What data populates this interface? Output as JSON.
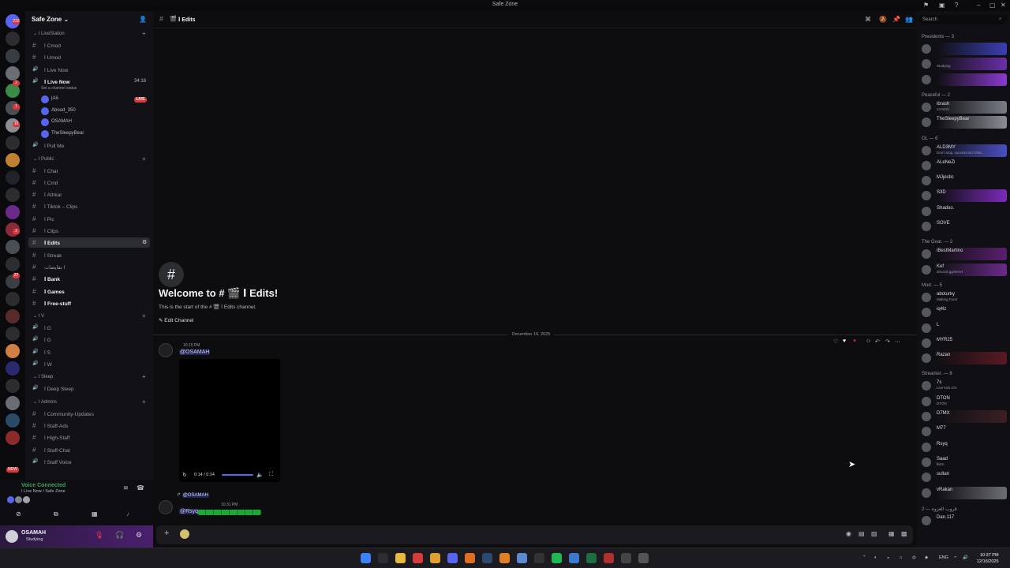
{
  "window": {
    "title": "Safe Zone"
  },
  "rail": {
    "top_badge": "232",
    "badges": [
      "2",
      "1",
      "10",
      "2",
      "27"
    ],
    "new_badge": "NEW"
  },
  "sidebar": {
    "server_name": "Safe Zone",
    "items": [
      {
        "type": "cat",
        "label": "ا LiveStation",
        "y": 25
      },
      {
        "type": "ch",
        "icon": "#",
        "label": "ا Cmod"
      },
      {
        "type": "ch",
        "icon": "#",
        "label": "ا Umod"
      },
      {
        "type": "vc",
        "icon": "🔊",
        "label": "ا Live Now"
      },
      {
        "type": "vc",
        "icon": "🔊",
        "label": "ا Live Now",
        "bold": true,
        "timer": "34:18"
      },
      {
        "type": "status",
        "label": "Set a channel status"
      },
      {
        "type": "vuser",
        "label": "|Ali-",
        "live": "LIVE"
      },
      {
        "type": "vuser",
        "label": "Abood_350"
      },
      {
        "type": "vuser",
        "label": "OSAMAH"
      },
      {
        "type": "vuser",
        "label": "TheSleepyBear"
      },
      {
        "type": "vc",
        "icon": "🔊",
        "label": "ا Pull Me"
      },
      {
        "type": "cat",
        "label": "ا Public"
      },
      {
        "type": "ch",
        "icon": "#",
        "label": "ا Chat"
      },
      {
        "type": "ch",
        "icon": "#",
        "label": "ا Cmd"
      },
      {
        "type": "ch",
        "icon": "#",
        "label": "ا Athkar"
      },
      {
        "type": "ch",
        "icon": "#",
        "label": "ا Tiktok – Clips"
      },
      {
        "type": "ch",
        "icon": "#",
        "label": "ا Pic"
      },
      {
        "type": "ch",
        "icon": "#",
        "label": "ا Clips"
      },
      {
        "type": "ch",
        "icon": "#",
        "label": "ا Edits",
        "active": true
      },
      {
        "type": "ch",
        "icon": "#",
        "label": "ا Streak"
      },
      {
        "type": "ch",
        "icon": "#",
        "label": "ا تقايضات"
      },
      {
        "type": "ch",
        "icon": "#",
        "label": "ا Bank",
        "bold": true
      },
      {
        "type": "ch",
        "icon": "#",
        "label": "ا Games",
        "bold": true
      },
      {
        "type": "ch",
        "icon": "#",
        "label": "ا Free-stuff",
        "bold": true
      },
      {
        "type": "cat",
        "label": "ا V"
      },
      {
        "type": "vc",
        "icon": "🔊",
        "label": "ا G"
      },
      {
        "type": "vc",
        "icon": "🔊",
        "label": "ا G"
      },
      {
        "type": "vc",
        "icon": "🔊",
        "label": "ا S"
      },
      {
        "type": "vc",
        "icon": "🔊",
        "label": "ا W"
      },
      {
        "type": "cat",
        "label": "ا Sleep"
      },
      {
        "type": "vc",
        "icon": "🔊",
        "label": "ا Deep Sleep"
      },
      {
        "type": "cat",
        "label": "ا Admins"
      },
      {
        "type": "ch",
        "icon": "#",
        "label": "ا Community-Updates"
      },
      {
        "type": "ch",
        "icon": "#",
        "label": "ا Staff-Ads"
      },
      {
        "type": "ch",
        "icon": "#",
        "label": "ا High-Staff"
      },
      {
        "type": "ch",
        "icon": "#",
        "label": "ا Staff-Chat"
      },
      {
        "type": "vc",
        "icon": "🔊",
        "label": "ا Staff Voice"
      }
    ]
  },
  "voice": {
    "status": "Voice Connected",
    "location": "ا Live Now / Safe Zone"
  },
  "user": {
    "name": "OSAMAH",
    "status": "Studying"
  },
  "channel_header": {
    "name": "ا Edits"
  },
  "welcome": {
    "title": "Welcome to # 🎬 ا Edits!",
    "subtitle": "This is the start of the # 🎬 ا Edits channel.",
    "edit_label": "Edit Channel"
  },
  "date_divider": "December 16, 2025",
  "messages": [
    {
      "time": "10:15 PM",
      "text": "@OSAMAH",
      "video_time": "0:14 / 0:14"
    },
    {
      "reply_to": "@OSAMAH",
      "time": "10:31 PM",
      "text": "@Rsyq"
    }
  ],
  "members": {
    "search_placeholder": "Search",
    "groups": [
      {
        "role": "Presidents — 3",
        "members": [
          {
            "name": "",
            "status": "",
            "bg": "#3b3fb0"
          },
          {
            "name": "",
            "status": "Studying",
            "bg": "#6b2fa8"
          },
          {
            "name": "",
            "status": "",
            "bg": "#8a3ad0"
          }
        ]
      },
      {
        "role": "Peaceful — 2",
        "members": [
          {
            "name": "ibrash",
            "status": "24 NOV",
            "bg": "#7a7d86"
          },
          {
            "name": "TheSleepyBear",
            "status": "",
            "bg": "#8b8e95"
          }
        ]
      },
      {
        "role": "OL — 6",
        "members": [
          {
            "name": "ALD3MY",
            "status": "Don't stop, success isn't that ...",
            "bg": "#4a4fc0"
          },
          {
            "name": "ALeNeZi",
            "status": "",
            "bg": ""
          },
          {
            "name": "MJjestic",
            "status": "",
            "bg": ""
          },
          {
            "name": "S3D",
            "status": "",
            "bg": "#7b2ab8"
          },
          {
            "name": "Shadoo.",
            "status": "",
            "bg": ""
          },
          {
            "name": "SOVE",
            "status": "",
            "bg": ""
          }
        ]
      },
      {
        "role": "The Goat. — 2",
        "members": [
          {
            "name": "iBestMartino",
            "status": "",
            "bg": "#5a1f6e"
          },
          {
            "name": "Kef",
            "status": "discord.gg/WAVI",
            "bg": "#6a2a8a"
          }
        ]
      },
      {
        "role": "Mod. — 5",
        "members": [
          {
            "name": "aboturky",
            "status": "Making Furor",
            "bg": ""
          },
          {
            "name": "iq4lz",
            "status": "",
            "bg": ""
          },
          {
            "name": "L",
            "status": "",
            "bg": ""
          },
          {
            "name": "MYR25",
            "status": "",
            "bg": ""
          },
          {
            "name": "Razan",
            "status": "",
            "bg": "#5a1a24"
          }
        ]
      },
      {
        "role": "Streamer. — 8",
        "members": [
          {
            "name": "7s",
            "status": "Live kick.s7s",
            "bg": ""
          },
          {
            "name": "DTON",
            "status": "DTON",
            "bg": ""
          },
          {
            "name": "D7MX",
            "status": "",
            "bg": "#3a1f24"
          },
          {
            "name": "M77",
            "status": "",
            "bg": ""
          },
          {
            "name": "Rsyq",
            "status": "",
            "bg": ""
          },
          {
            "name": "Saad",
            "status": "fkkm",
            "bg": ""
          },
          {
            "name": "sultan",
            "status": "",
            "bg": ""
          },
          {
            "name": "vRakan",
            "status": "",
            "bg": "#6b6e74"
          }
        ]
      },
      {
        "role": "2 — قروب العزوه",
        "members": [
          {
            "name": "Dan.117",
            "status": "",
            "bg": ""
          }
        ]
      }
    ]
  },
  "taskbar": {
    "lang": "ENG",
    "time": "10:37 PM",
    "date": "12/16/2025"
  }
}
